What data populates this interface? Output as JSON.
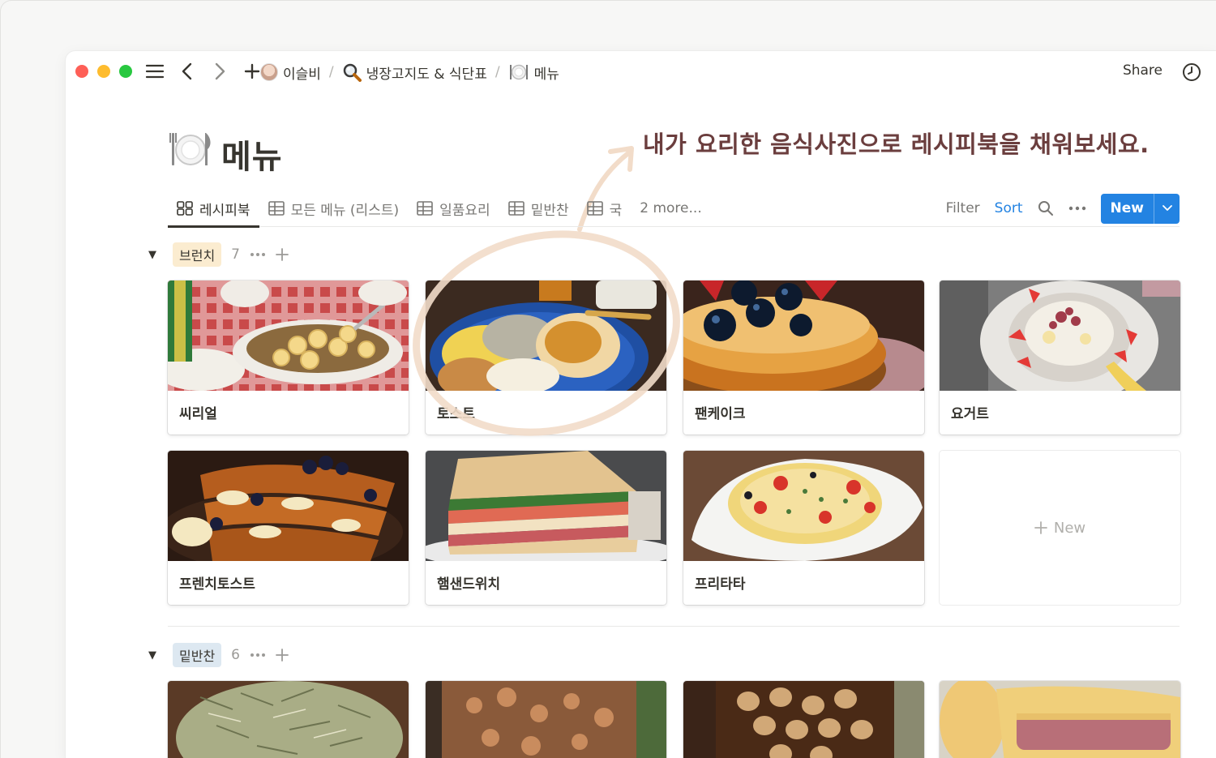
{
  "topbar": {
    "breadcrumbs": [
      {
        "label": "이슬비",
        "icon": "avatar"
      },
      {
        "label": "냉장고지도 & 식단표",
        "icon": "magnifier-emoji-icon"
      },
      {
        "label": "메뉴",
        "icon": "plate-emoji-icon"
      }
    ],
    "share_label": "Share"
  },
  "page": {
    "title": "메뉴",
    "annotation": "내가 요리한 음식사진으로 레시피북을 채워보세요."
  },
  "views": {
    "tabs": [
      {
        "label": "레시피북",
        "icon": "gallery-icon",
        "active": true
      },
      {
        "label": "모든 메뉴 (리스트)",
        "icon": "table-icon",
        "active": false
      },
      {
        "label": "일품요리",
        "icon": "table-icon",
        "active": false
      },
      {
        "label": "밑반찬",
        "icon": "table-icon",
        "active": false
      },
      {
        "label": "국",
        "icon": "table-icon",
        "active": false
      }
    ],
    "more_label": "2 more...",
    "filter_label": "Filter",
    "sort_label": "Sort",
    "new_label": "New",
    "accent": "#2383e2"
  },
  "groups": [
    {
      "tag": "브런치",
      "tag_color": "#fbecd0",
      "count": "7",
      "cards": [
        "씨리얼",
        "토스트",
        "팬케이크",
        "요거트",
        "프렌치토스트",
        "햄샌드위치",
        "프리타타"
      ],
      "new_card_label": "New"
    },
    {
      "tag": "밑반찬",
      "tag_color": "#dde8f1",
      "count": "6",
      "cards": [
        "",
        "",
        "",
        ""
      ]
    }
  ]
}
